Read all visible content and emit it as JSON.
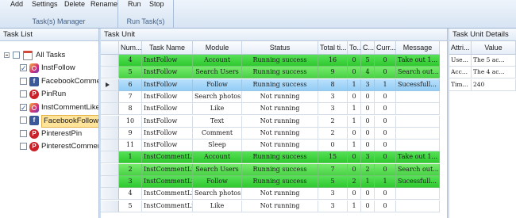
{
  "ribbon": {
    "groups": [
      {
        "caption": "Task(s) Manager",
        "buttons": [
          "Add",
          "Settings",
          "Delete",
          "Rename"
        ]
      },
      {
        "caption": "Run Task(s)",
        "buttons": [
          "Run",
          "Stop"
        ]
      }
    ]
  },
  "task_list": {
    "title": "Task List",
    "root": {
      "label": "All Tasks",
      "icon": "calendar-icon"
    },
    "items": [
      {
        "label": "InstFollow",
        "icon": "instagram-icon",
        "checked": true,
        "selected": false
      },
      {
        "label": "FacebookCommer",
        "icon": "facebook-icon",
        "checked": false,
        "selected": false
      },
      {
        "label": "PinRun",
        "icon": "pinterest-icon",
        "checked": false,
        "selected": false
      },
      {
        "label": "InstCommentLike",
        "icon": "instagram-icon",
        "checked": true,
        "selected": false
      },
      {
        "label": "FacebookFollow",
        "icon": "facebook-icon",
        "checked": false,
        "selected": true
      },
      {
        "label": "PinterestPin",
        "icon": "pinterest-icon",
        "checked": false,
        "selected": false
      },
      {
        "label": "PinterestCommen",
        "icon": "pinterest-icon",
        "checked": false,
        "selected": false
      }
    ]
  },
  "task_unit": {
    "title": "Task Unit",
    "columns": [
      "Num...",
      "Task Name",
      "Module",
      "Status",
      "Total ti...",
      "To...",
      "C...",
      "Curr...",
      "Message"
    ],
    "rows": [
      {
        "style": "green",
        "cells": [
          "4",
          "InstFollow",
          "Account",
          "Running success",
          "16",
          "0",
          "5",
          "0",
          "Take out 1..."
        ]
      },
      {
        "style": "green-alt",
        "cells": [
          "5",
          "InstFollow",
          "Search Users",
          "Running success",
          "9",
          "0",
          "4",
          "0",
          "Search out..."
        ]
      },
      {
        "style": "blue",
        "cells": [
          "6",
          "InstFollow",
          "Follow",
          "Running success",
          "8",
          "1",
          "3",
          "1",
          "Sucessfull..."
        ]
      },
      {
        "style": "plain",
        "cells": [
          "7",
          "InstFollow",
          "Search photos",
          "Not running",
          "3",
          "0",
          "0",
          "0",
          ""
        ]
      },
      {
        "style": "plain",
        "cells": [
          "8",
          "InstFollow",
          "Like",
          "Not running",
          "3",
          "1",
          "0",
          "0",
          ""
        ]
      },
      {
        "style": "plain",
        "cells": [
          "10",
          "InstFollow",
          "Text",
          "Not running",
          "2",
          "1",
          "0",
          "0",
          ""
        ]
      },
      {
        "style": "plain",
        "cells": [
          "9",
          "InstFollow",
          "Comment",
          "Not running",
          "2",
          "0",
          "0",
          "0",
          ""
        ]
      },
      {
        "style": "plain",
        "cells": [
          "11",
          "InstFollow",
          "Sleep",
          "Not running",
          "0",
          "1",
          "0",
          "0",
          ""
        ]
      },
      {
        "style": "green",
        "cells": [
          "1",
          "InstCommentLike",
          "Account",
          "Running success",
          "15",
          "0",
          "3",
          "0",
          "Take out 1..."
        ]
      },
      {
        "style": "green-alt",
        "cells": [
          "2",
          "InstCommentLike",
          "Search Users",
          "Running success",
          "7",
          "0",
          "2",
          "0",
          "Search out..."
        ]
      },
      {
        "style": "green",
        "cells": [
          "3",
          "InstCommentLike",
          "Follow",
          "Running success",
          "5",
          "2",
          "1",
          "1",
          "Sucessfull..."
        ]
      },
      {
        "style": "plain",
        "cells": [
          "4",
          "InstCommentLike",
          "Search photos",
          "Not running",
          "3",
          "0",
          "0",
          "0",
          ""
        ]
      },
      {
        "style": "plain",
        "cells": [
          "5",
          "InstCommentLike",
          "Like",
          "Not running",
          "3",
          "1",
          "0",
          "0",
          ""
        ]
      }
    ]
  },
  "task_unit_details": {
    "title": "Task Unit Details",
    "columns": [
      "Attri...",
      "Value"
    ],
    "rows": [
      [
        "Use...",
        "The 5 ac..."
      ],
      [
        "Acc...",
        "The 4 ac..."
      ],
      [
        "Tim...",
        "240"
      ]
    ]
  }
}
